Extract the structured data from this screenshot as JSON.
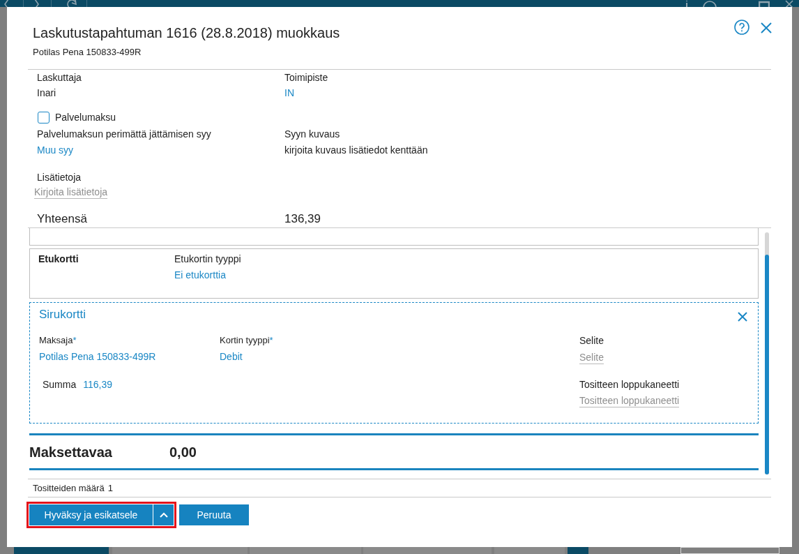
{
  "dialog": {
    "title": "Laskutustapahtuman 1616 (28.8.2018) muokkaus",
    "subtitle": "Potilas Pena 150833-499R"
  },
  "details": {
    "billing": [
      {
        "label": "Laskuttaja",
        "value": "Inari",
        "kind": "text"
      },
      {
        "label": "Toimipiste",
        "value": "IN",
        "kind": "link"
      }
    ],
    "service_fee": {
      "label": "Palvelumaksu",
      "checked": false
    },
    "waiver": [
      {
        "label": "Palvelumaksun perimättä jättämisen syy",
        "value": "Muu syy",
        "kind": "link"
      },
      {
        "label": "Syyn kuvaus",
        "value": "kirjoita kuvaus lisätiedot kenttään",
        "kind": "text"
      }
    ],
    "additional_info": {
      "label": "Lisätietoja",
      "placeholder": "Kirjoita lisätietoja"
    },
    "total": {
      "label": "Yhteensä",
      "value": "136,39"
    }
  },
  "payments": [
    {
      "kind": "benefit_card",
      "title": "Etukortti",
      "type_label": "Etukortin tyyppi",
      "type_value": "Ei etukorttia"
    },
    {
      "kind": "chip_card",
      "title": "Sirukortti",
      "payer": {
        "label": "Maksaja",
        "required_mark": "*",
        "value": "Potilas Pena 150833-499R"
      },
      "card_type": {
        "label": "Kortin tyyppi",
        "required_mark": "*",
        "value": "Debit"
      },
      "description": {
        "label": "Selite",
        "placeholder": "Selite"
      },
      "sum": {
        "label": "Summa",
        "value": "116,39"
      },
      "closing_note": {
        "label": "Tositteen loppukaneetti",
        "placeholder": "Tositteen loppukaneetti"
      }
    }
  ],
  "amount_due": {
    "label": "Maksettavaa",
    "value": "0,00"
  },
  "receipt_count": {
    "label": "Tositteiden määrä",
    "value": "1"
  },
  "buttons": [
    {
      "kind": "split",
      "label": "Hyväksy ja esikatsele",
      "highlighted": true
    },
    {
      "kind": "plain",
      "label": "Peruuta",
      "highlighted": false
    }
  ]
}
